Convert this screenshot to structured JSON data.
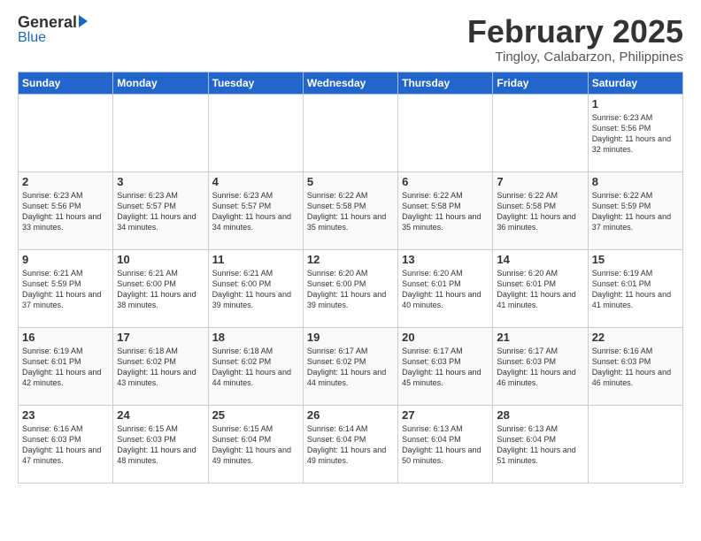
{
  "header": {
    "logo_general": "General",
    "logo_blue": "Blue",
    "month": "February 2025",
    "location": "Tingloy, Calabarzon, Philippines"
  },
  "days_of_week": [
    "Sunday",
    "Monday",
    "Tuesday",
    "Wednesday",
    "Thursday",
    "Friday",
    "Saturday"
  ],
  "weeks": [
    [
      {
        "day": "",
        "info": ""
      },
      {
        "day": "",
        "info": ""
      },
      {
        "day": "",
        "info": ""
      },
      {
        "day": "",
        "info": ""
      },
      {
        "day": "",
        "info": ""
      },
      {
        "day": "",
        "info": ""
      },
      {
        "day": "1",
        "info": "Sunrise: 6:23 AM\nSunset: 5:56 PM\nDaylight: 11 hours\nand 32 minutes."
      }
    ],
    [
      {
        "day": "2",
        "info": "Sunrise: 6:23 AM\nSunset: 5:56 PM\nDaylight: 11 hours\nand 33 minutes."
      },
      {
        "day": "3",
        "info": "Sunrise: 6:23 AM\nSunset: 5:57 PM\nDaylight: 11 hours\nand 34 minutes."
      },
      {
        "day": "4",
        "info": "Sunrise: 6:23 AM\nSunset: 5:57 PM\nDaylight: 11 hours\nand 34 minutes."
      },
      {
        "day": "5",
        "info": "Sunrise: 6:22 AM\nSunset: 5:58 PM\nDaylight: 11 hours\nand 35 minutes."
      },
      {
        "day": "6",
        "info": "Sunrise: 6:22 AM\nSunset: 5:58 PM\nDaylight: 11 hours\nand 35 minutes."
      },
      {
        "day": "7",
        "info": "Sunrise: 6:22 AM\nSunset: 5:58 PM\nDaylight: 11 hours\nand 36 minutes."
      },
      {
        "day": "8",
        "info": "Sunrise: 6:22 AM\nSunset: 5:59 PM\nDaylight: 11 hours\nand 37 minutes."
      }
    ],
    [
      {
        "day": "9",
        "info": "Sunrise: 6:21 AM\nSunset: 5:59 PM\nDaylight: 11 hours\nand 37 minutes."
      },
      {
        "day": "10",
        "info": "Sunrise: 6:21 AM\nSunset: 6:00 PM\nDaylight: 11 hours\nand 38 minutes."
      },
      {
        "day": "11",
        "info": "Sunrise: 6:21 AM\nSunset: 6:00 PM\nDaylight: 11 hours\nand 39 minutes."
      },
      {
        "day": "12",
        "info": "Sunrise: 6:20 AM\nSunset: 6:00 PM\nDaylight: 11 hours\nand 39 minutes."
      },
      {
        "day": "13",
        "info": "Sunrise: 6:20 AM\nSunset: 6:01 PM\nDaylight: 11 hours\nand 40 minutes."
      },
      {
        "day": "14",
        "info": "Sunrise: 6:20 AM\nSunset: 6:01 PM\nDaylight: 11 hours\nand 41 minutes."
      },
      {
        "day": "15",
        "info": "Sunrise: 6:19 AM\nSunset: 6:01 PM\nDaylight: 11 hours\nand 41 minutes."
      }
    ],
    [
      {
        "day": "16",
        "info": "Sunrise: 6:19 AM\nSunset: 6:01 PM\nDaylight: 11 hours\nand 42 minutes."
      },
      {
        "day": "17",
        "info": "Sunrise: 6:18 AM\nSunset: 6:02 PM\nDaylight: 11 hours\nand 43 minutes."
      },
      {
        "day": "18",
        "info": "Sunrise: 6:18 AM\nSunset: 6:02 PM\nDaylight: 11 hours\nand 44 minutes."
      },
      {
        "day": "19",
        "info": "Sunrise: 6:17 AM\nSunset: 6:02 PM\nDaylight: 11 hours\nand 44 minutes."
      },
      {
        "day": "20",
        "info": "Sunrise: 6:17 AM\nSunset: 6:03 PM\nDaylight: 11 hours\nand 45 minutes."
      },
      {
        "day": "21",
        "info": "Sunrise: 6:17 AM\nSunset: 6:03 PM\nDaylight: 11 hours\nand 46 minutes."
      },
      {
        "day": "22",
        "info": "Sunrise: 6:16 AM\nSunset: 6:03 PM\nDaylight: 11 hours\nand 46 minutes."
      }
    ],
    [
      {
        "day": "23",
        "info": "Sunrise: 6:16 AM\nSunset: 6:03 PM\nDaylight: 11 hours\nand 47 minutes."
      },
      {
        "day": "24",
        "info": "Sunrise: 6:15 AM\nSunset: 6:03 PM\nDaylight: 11 hours\nand 48 minutes."
      },
      {
        "day": "25",
        "info": "Sunrise: 6:15 AM\nSunset: 6:04 PM\nDaylight: 11 hours\nand 49 minutes."
      },
      {
        "day": "26",
        "info": "Sunrise: 6:14 AM\nSunset: 6:04 PM\nDaylight: 11 hours\nand 49 minutes."
      },
      {
        "day": "27",
        "info": "Sunrise: 6:13 AM\nSunset: 6:04 PM\nDaylight: 11 hours\nand 50 minutes."
      },
      {
        "day": "28",
        "info": "Sunrise: 6:13 AM\nSunset: 6:04 PM\nDaylight: 11 hours\nand 51 minutes."
      },
      {
        "day": "",
        "info": ""
      }
    ]
  ]
}
